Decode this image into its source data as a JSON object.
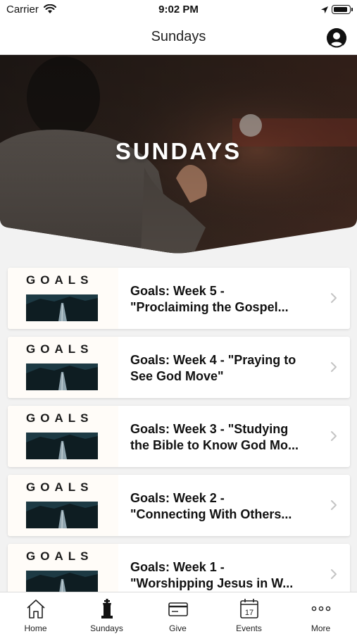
{
  "status_bar": {
    "carrier": "Carrier",
    "time": "9:02 PM"
  },
  "nav": {
    "title": "Sundays"
  },
  "hero": {
    "title": "SUNDAYS"
  },
  "list": {
    "items": [
      {
        "thumb_word": "GOALS",
        "title_line1": "Goals: Week 5 -",
        "title_line2": "\"Proclaiming the Gospel..."
      },
      {
        "thumb_word": "GOALS",
        "title_line1": "Goals: Week 4 - \"Praying to",
        "title_line2": "See God Move\""
      },
      {
        "thumb_word": "GOALS",
        "title_line1": "Goals: Week 3 - \"Studying",
        "title_line2": "the Bible to Know God Mo..."
      },
      {
        "thumb_word": "GOALS",
        "title_line1": "Goals: Week 2 -",
        "title_line2": "\"Connecting With Others..."
      },
      {
        "thumb_word": "GOALS",
        "title_line1": "Goals: Week 1 -",
        "title_line2": "\"Worshipping Jesus in W..."
      }
    ]
  },
  "tabs": [
    {
      "label": "Home",
      "icon": "home-icon"
    },
    {
      "label": "Sundays",
      "icon": "sundays-icon"
    },
    {
      "label": "Give",
      "icon": "give-card-icon"
    },
    {
      "label": "Events",
      "icon": "calendar-icon",
      "icon_text": "17"
    },
    {
      "label": "More",
      "icon": "more-dots-icon"
    }
  ]
}
